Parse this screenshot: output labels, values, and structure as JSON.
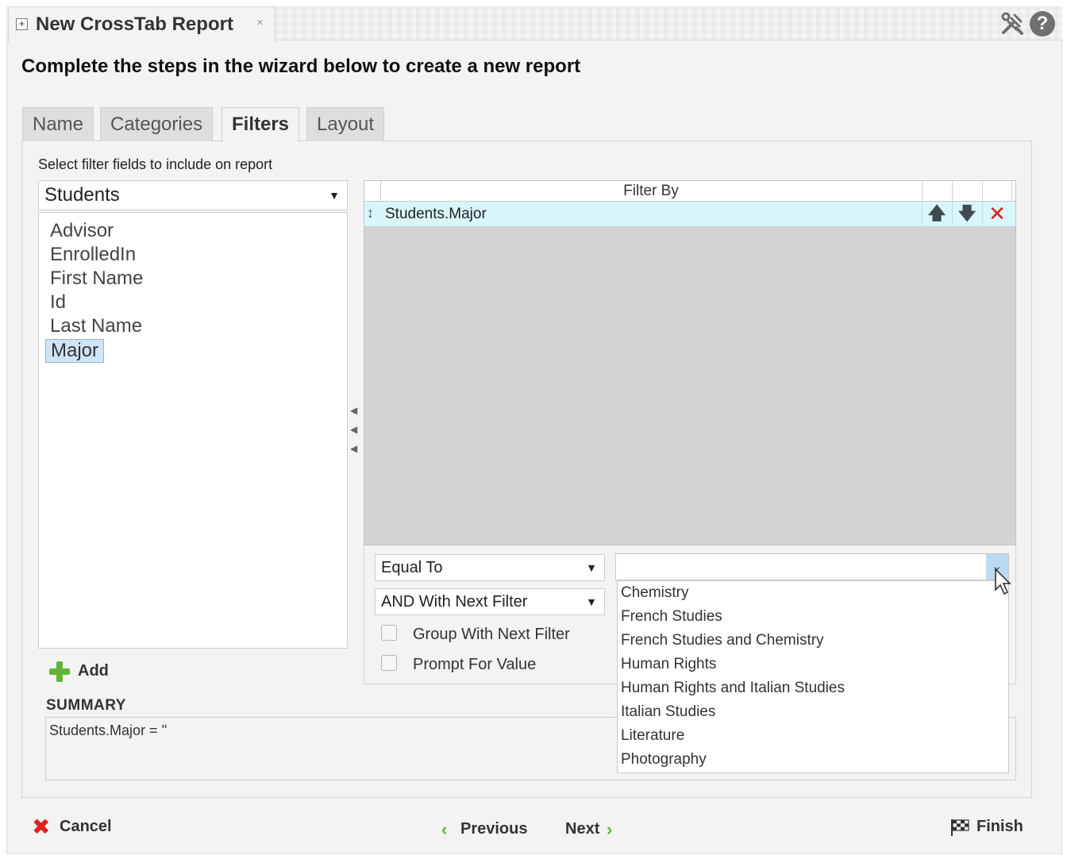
{
  "document_tab": {
    "plus_icon": "expand-plus-icon",
    "title": "New CrossTab Report",
    "close_glyph": "×"
  },
  "toolbar": {
    "tools_icon": "tools-icon",
    "help_glyph": "?"
  },
  "wizard": {
    "heading": "Complete the steps in the wizard below to create a new report",
    "tabs": [
      {
        "label": "Name"
      },
      {
        "label": "Categories"
      },
      {
        "label": "Filters",
        "active": true
      },
      {
        "label": "Layout"
      }
    ]
  },
  "filters": {
    "select_label": "Select filter fields to include on report",
    "table_select": "Students",
    "fields": [
      {
        "label": "Advisor"
      },
      {
        "label": "EnrolledIn"
      },
      {
        "label": "First Name"
      },
      {
        "label": "Id"
      },
      {
        "label": "Last Name"
      },
      {
        "label": "Major",
        "selected": true
      }
    ],
    "add_label": "Add"
  },
  "filter_grid": {
    "header": "Filter By",
    "rows": [
      {
        "field": "Students.Major"
      }
    ]
  },
  "filter_options": {
    "operator": "Equal To",
    "conjunction": "AND With Next Filter",
    "group_label": "Group With Next Filter",
    "group_checked": false,
    "prompt_label": "Prompt For Value",
    "prompt_checked": false
  },
  "value_picker": {
    "value": "",
    "options": [
      "Chemistry",
      "French Studies",
      "French Studies and Chemistry",
      "Human Rights",
      "Human Rights and Italian Studies",
      "Italian Studies",
      "Literature",
      "Photography"
    ]
  },
  "summary": {
    "label": "SUMMARY",
    "text": "Students.Major = ''"
  },
  "footer": {
    "cancel": "Cancel",
    "previous": "Previous",
    "next": "Next",
    "finish": "Finish"
  },
  "colors": {
    "selection": "#cfe4f7",
    "row_highlight": "#d9f6fb",
    "grid_bg": "#d3d3d3",
    "accent_green": "#5fb436",
    "delete_red": "#e0201b"
  }
}
